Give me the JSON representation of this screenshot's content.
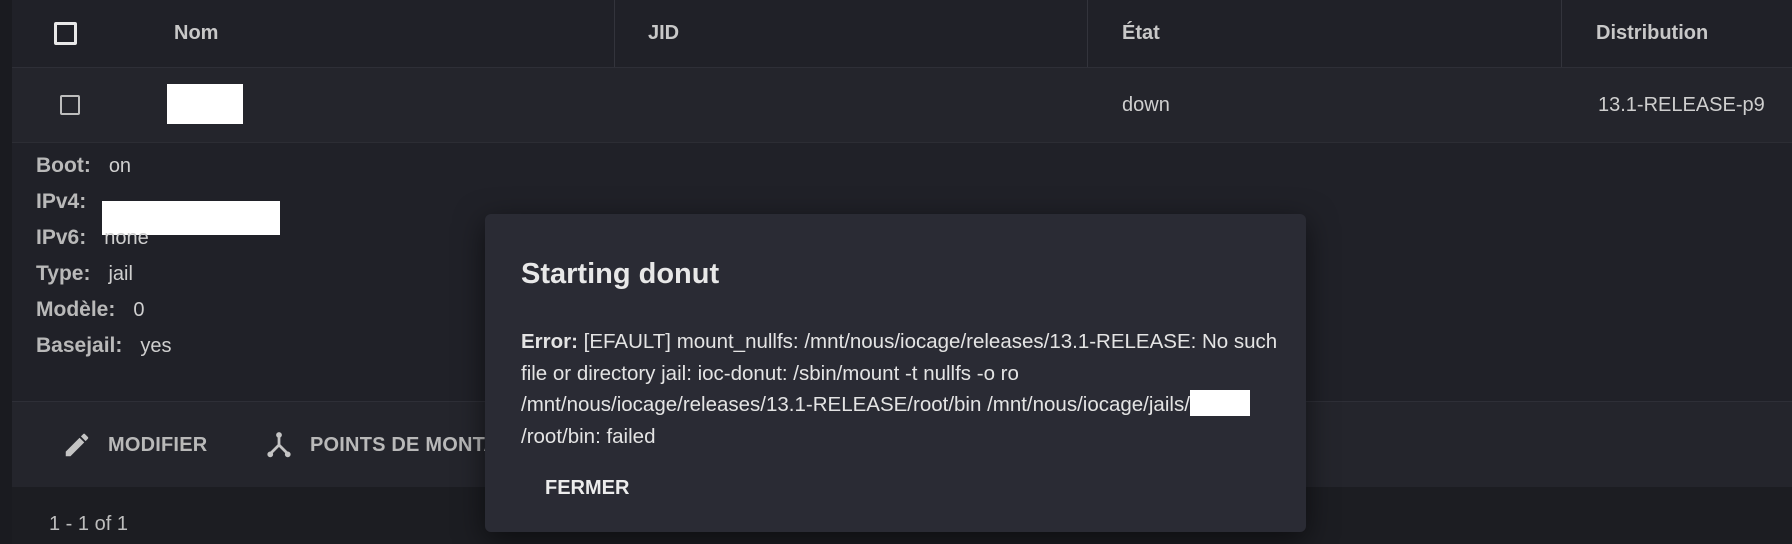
{
  "table": {
    "headers": {
      "name": "Nom",
      "jid": "JID",
      "state": "État",
      "distribution": "Distribution"
    },
    "row": {
      "state": "down",
      "distribution": "13.1-RELEASE-p9"
    },
    "details": [
      {
        "key": "Boot:",
        "value": "on"
      },
      {
        "key": "IPv4:",
        "value": ""
      },
      {
        "key": "IPv6:",
        "value": "none"
      },
      {
        "key": "Type:",
        "value": "jail"
      },
      {
        "key": "Modèle:",
        "value": "0"
      },
      {
        "key": "Basejail:",
        "value": "yes"
      }
    ],
    "actions": {
      "edit_label": "MODIFIER",
      "mounts_label": "POINTS DE MONTA"
    },
    "pager": "1 - 1 of 1"
  },
  "modal": {
    "title": "Starting donut",
    "error_label": "Error:",
    "error_text_1": " [EFAULT] mount_nullfs: /mnt/nous/iocage/releases/13.1-RELEASE: No such file or directory jail: ioc-donut: /sbin/mount -t nullfs -o ro /mnt/nous/iocage/releases/13.1-RELEASE/root/bin /mnt/nous/iocage/jails/",
    "error_text_2": "/root/bin: failed",
    "close_label": "FERMER"
  },
  "colors": {
    "background": "#1a1b20",
    "panel": "#202128",
    "row": "#24252c",
    "modal": "#2a2b34"
  },
  "icons": {
    "edit": "pencil-icon",
    "mounts": "fork-icon"
  }
}
